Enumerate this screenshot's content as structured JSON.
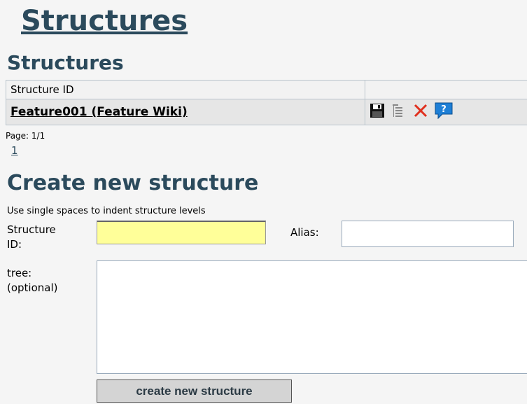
{
  "page": {
    "title": "Structures"
  },
  "list": {
    "title": "Structures",
    "column_header": "Structure ID",
    "rows": [
      {
        "name": "Feature001 (Feature Wiki)",
        "actions": [
          "save-icon",
          "tree-icon",
          "delete-icon",
          "help-icon"
        ]
      }
    ],
    "pager_label": "Page: 1/1",
    "pager_link": "1"
  },
  "create": {
    "title": "Create new structure",
    "hint": "Use single spaces to indent structure levels",
    "structure_id_label_1": "Structure",
    "structure_id_label_2": "ID:",
    "structure_id_value": "",
    "alias_label": "Alias:",
    "alias_value": "",
    "tree_label_1": "tree:",
    "tree_label_2": "(optional)",
    "tree_value": "",
    "submit_label": "create new structure"
  },
  "colors": {
    "heading": "#2b4a5c",
    "id_field_bg": "#ffff99",
    "delete": "#e0301e",
    "help": "#1e7fd6"
  }
}
